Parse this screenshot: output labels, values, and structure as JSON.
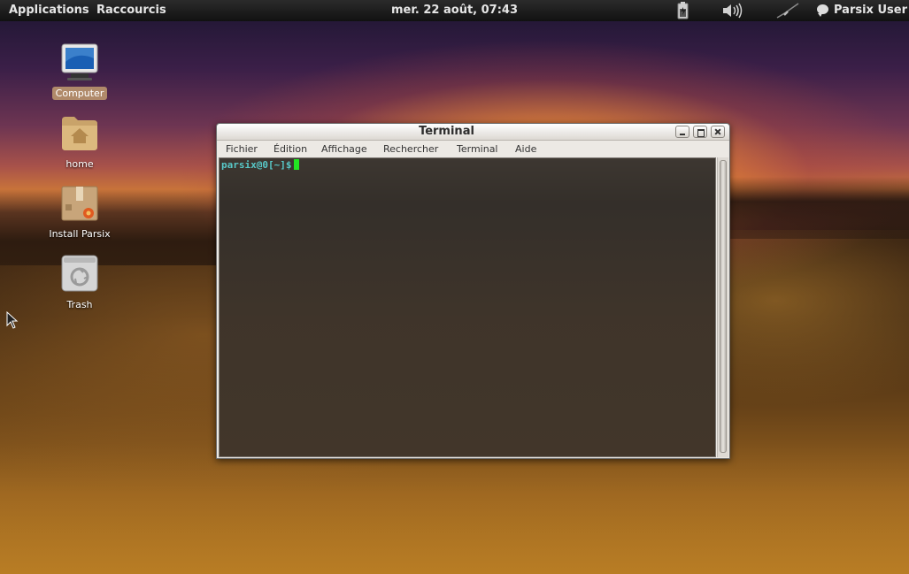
{
  "top_panel": {
    "applications_label": "Applications",
    "raccourcis_label": "Raccourcis",
    "clock": "mer. 22 août, 07:43",
    "user_label": "Parsix User",
    "tray_icons": [
      "battery-icon",
      "volume-icon",
      "network-icon"
    ]
  },
  "desktop": {
    "icons": [
      {
        "label": "Computer",
        "icon": "computer-icon",
        "selected": true
      },
      {
        "label": "home",
        "icon": "home-folder-icon"
      },
      {
        "label": "Install Parsix",
        "icon": "installer-package-icon"
      },
      {
        "label": "Trash",
        "icon": "trash-icon"
      }
    ]
  },
  "terminal": {
    "title": "Terminal",
    "menu": [
      "Fichier",
      "Édition",
      "Affichage",
      "Rechercher",
      "Terminal",
      "Aide"
    ],
    "prompt": "parsix@0[~]$"
  },
  "colors": {
    "prompt": "#58c8c8",
    "cursor": "#22e622",
    "panel": "#1a1a1a",
    "selected_icon_label": "#b08a6a"
  }
}
